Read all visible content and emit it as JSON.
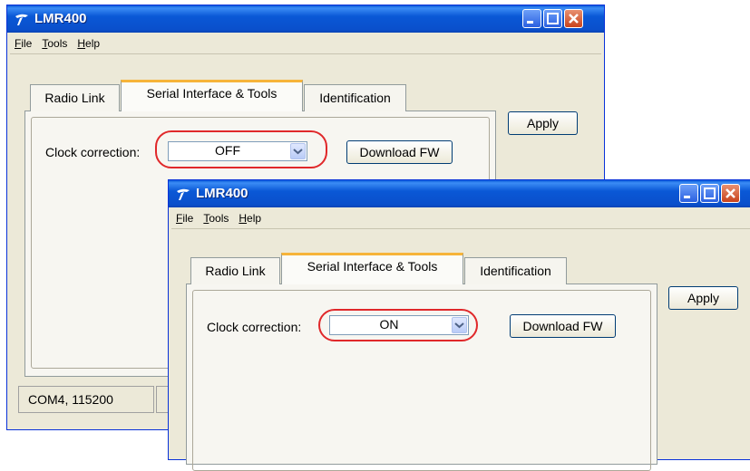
{
  "window_back": {
    "title": "LMR400",
    "menu": [
      "File",
      "Tools",
      "Help"
    ],
    "tabs": [
      "Radio Link",
      "Serial Interface & Tools",
      "Identification"
    ],
    "apply_label": "Apply",
    "clock_label": "Clock correction:",
    "clock_value": "OFF",
    "download_label": "Download FW",
    "status_port": "COM4, 115200"
  },
  "window_front": {
    "title": "LMR400",
    "menu": [
      "File",
      "Tools",
      "Help"
    ],
    "tabs": [
      "Radio Link",
      "Serial Interface & Tools",
      "Identification"
    ],
    "apply_label": "Apply",
    "clock_label": "Clock correction:",
    "clock_value": "ON",
    "download_label": "Download FW"
  },
  "colors": {
    "titlebar": "#0a58d6",
    "highlight_circle": "#e0282a",
    "active_tab_accent": "#f6b43a"
  }
}
